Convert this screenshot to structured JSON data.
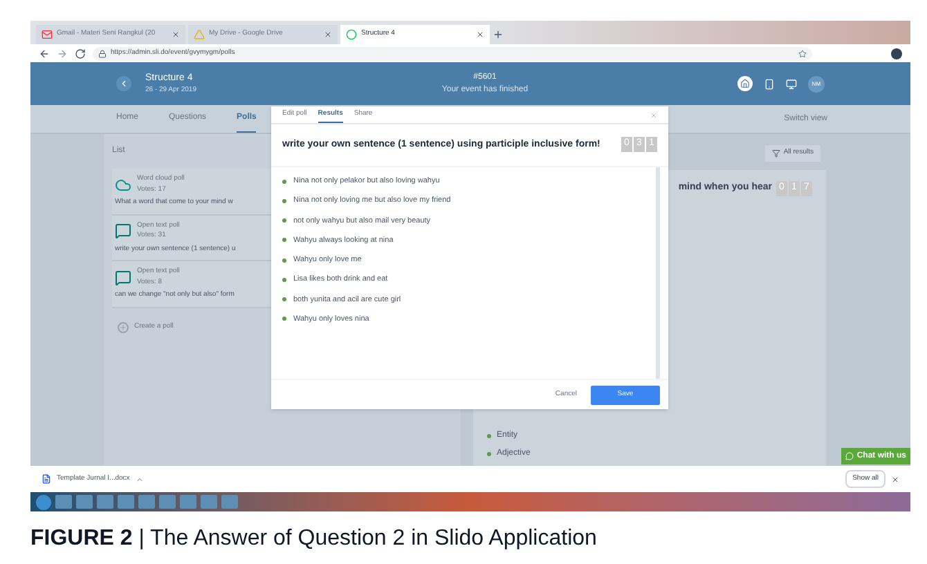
{
  "browser": {
    "tabs": [
      {
        "label": "Gmail - Materi Seni Rangkul (20",
        "kind": "mail",
        "selected": false
      },
      {
        "label": "My Drive - Google Drive",
        "kind": "drive",
        "selected": false
      },
      {
        "label": "Structure 4",
        "kind": "slido",
        "selected": true
      }
    ],
    "url": "https://admin.sli.do/event/gvymygm/polls"
  },
  "header": {
    "event_title": "Structure 4",
    "dates": "26 - 29 Apr 2019",
    "event_code": "#5601",
    "status": "Your event has finished",
    "avatar": "NM"
  },
  "nav": {
    "tabs": [
      {
        "label": "Home",
        "selected": false
      },
      {
        "label": "Questions",
        "selected": false
      },
      {
        "label": "Polls",
        "selected": true
      }
    ],
    "switch_view": "Switch view"
  },
  "polls_list": {
    "title": "List",
    "polls": [
      {
        "kind": "word_cloud",
        "type": "Word cloud poll",
        "votes": "Votes: 17",
        "question": "What a word that come to your mind w"
      },
      {
        "kind": "open_text",
        "type": "Open text poll",
        "votes": "Votes: 31",
        "question": "write your own sentence (1 sentence) u"
      },
      {
        "kind": "open_text",
        "type": "Open text poll",
        "votes": "Votes: 8",
        "question": "can we change \"not only but also\" form"
      }
    ],
    "create": "Create a poll"
  },
  "results_panel": {
    "all_results": "All results",
    "question": "mind when you hear",
    "counter": [
      "0",
      "1",
      "7"
    ],
    "answers": [
      "Entity",
      "Adjective"
    ]
  },
  "modal": {
    "tabs": [
      {
        "label": "Edit poll",
        "selected": false
      },
      {
        "label": "Results",
        "selected": true
      },
      {
        "label": "Share",
        "selected": false
      }
    ],
    "question": "write your own sentence (1 sentence) using participle inclusive form!",
    "counter": [
      "0",
      "3",
      "1"
    ],
    "answers": [
      "Nina not only pelakor but also loving wahyu",
      "Nina not only loving me but also love my friend",
      "not only wahyu but also mail very beauty",
      "Wahyu always looking at nina",
      "Wahyu only love me",
      "Lisa likes both drink and eat",
      "both yunita and acil are cute girl",
      "Wahyu only loves nina"
    ],
    "cancel": "Cancel",
    "save": "Save"
  },
  "chat_button": "Chat with us",
  "downloads": {
    "file": "Template Jurnal I...docx",
    "show_all": "Show all"
  },
  "caption": "**FIGURE 2** | The Answer of Question 2 in Slido Application"
}
